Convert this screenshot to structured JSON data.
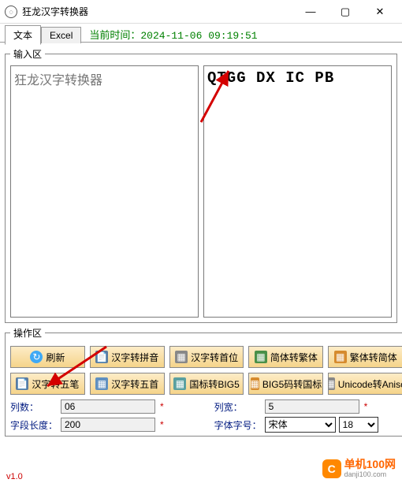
{
  "window": {
    "title": "狂龙汉字转换器"
  },
  "tabs": {
    "text": "文本",
    "excel": "Excel",
    "time_prefix": "当前时间：",
    "time_value": "2024-11-06  09:19:51"
  },
  "input_area": {
    "legend": "输入区",
    "placeholder": "狂龙汉字转换器",
    "output": "QTGG DX IC PB"
  },
  "ops": {
    "legend": "操作区",
    "btns": [
      {
        "label": "刷新",
        "icon": "refresh"
      },
      {
        "label": "汉字转拼音",
        "icon": "doc"
      },
      {
        "label": "汉字转首位",
        "icon": "gray"
      },
      {
        "label": "简体转繁体",
        "icon": "green"
      },
      {
        "label": "繁体转简体",
        "icon": "orange"
      },
      {
        "label": "汉字转五笔",
        "icon": "doc"
      },
      {
        "label": "汉字转五首",
        "icon": "blue2"
      },
      {
        "label": "国标转BIG5",
        "icon": "teal"
      },
      {
        "label": "BIG5码转国标",
        "icon": "orange"
      },
      {
        "label": "Unicode转Anisc",
        "icon": "gray"
      }
    ],
    "params": {
      "cols_label": "列数：",
      "cols_value": "06",
      "width_label": "列宽：",
      "width_value": "5",
      "len_label": "字段长度：",
      "len_value": "200",
      "font_label": "字体字号：",
      "font_name": "宋体",
      "font_size": "18"
    }
  },
  "footer": {
    "version": "v1.0"
  },
  "watermark": {
    "site": "单机100网",
    "domain": "danji100.com"
  }
}
